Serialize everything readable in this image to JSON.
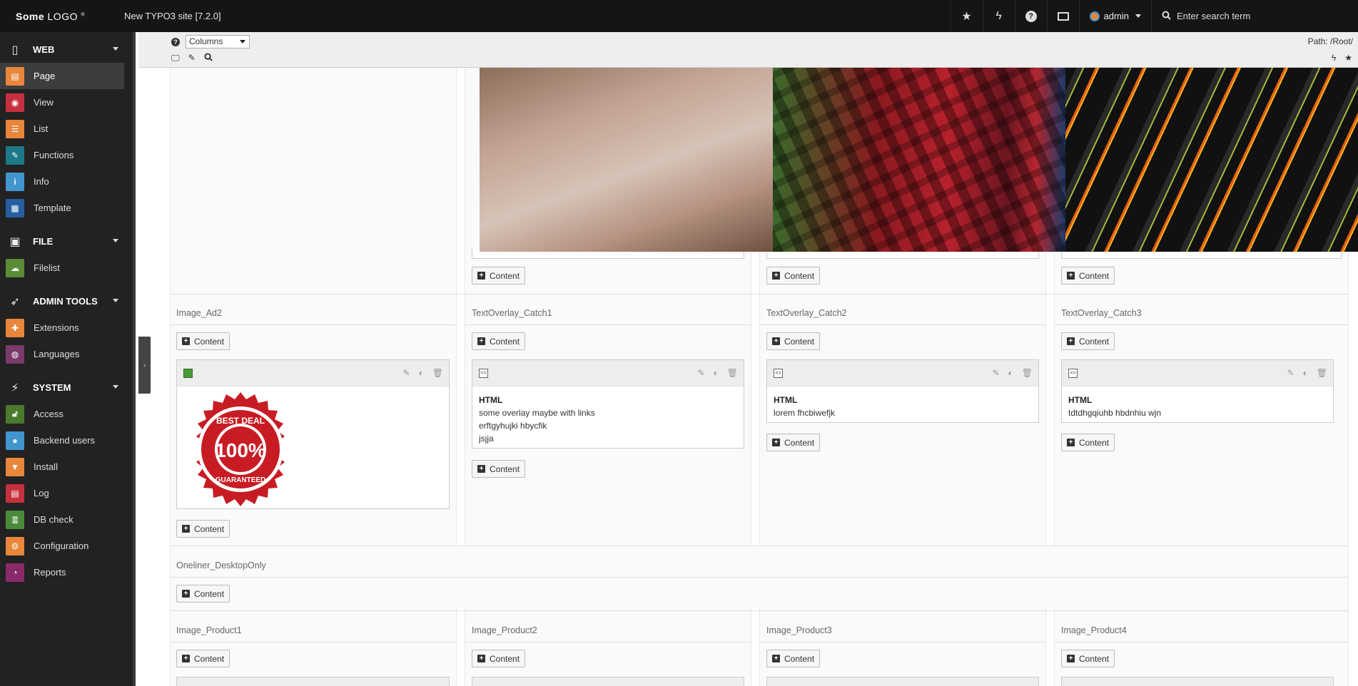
{
  "topbar": {
    "logo_bold": "Some",
    "logo_light": "LOGO",
    "site_name": "New TYPO3 site [7.2.0]",
    "user": "admin",
    "search_placeholder": "Enter search term"
  },
  "sidebar": {
    "sections": [
      {
        "label": "WEB",
        "icon": "page-icon",
        "items": [
          {
            "label": "Page",
            "icon": "page-module-icon",
            "color": "#e8863b",
            "active": true
          },
          {
            "label": "View",
            "icon": "eye-icon",
            "color": "#c6303e"
          },
          {
            "label": "List",
            "icon": "list-icon",
            "color": "#e8863b"
          },
          {
            "label": "Functions",
            "icon": "wand-icon",
            "color": "#1d7888"
          },
          {
            "label": "Info",
            "icon": "info-icon",
            "color": "#4196ce"
          },
          {
            "label": "Template",
            "icon": "template-icon",
            "color": "#255fa2"
          }
        ]
      },
      {
        "label": "FILE",
        "icon": "image-icon",
        "items": [
          {
            "label": "Filelist",
            "icon": "cloud-icon",
            "color": "#5a8c35"
          }
        ]
      },
      {
        "label": "ADMIN TOOLS",
        "icon": "rocket-icon",
        "items": [
          {
            "label": "Extensions",
            "icon": "puzzle-icon",
            "color": "#e8863b"
          },
          {
            "label": "Languages",
            "icon": "globe-icon",
            "color": "#7a3a6a"
          }
        ]
      },
      {
        "label": "SYSTEM",
        "icon": "plug-icon",
        "items": [
          {
            "label": "Access",
            "icon": "lock-icon",
            "color": "#4a7a2c"
          },
          {
            "label": "Backend users",
            "icon": "user-icon",
            "color": "#4196ce"
          },
          {
            "label": "Install",
            "icon": "typo3-icon",
            "color": "#e8863b"
          },
          {
            "label": "Log",
            "icon": "log-icon",
            "color": "#c6303e"
          },
          {
            "label": "DB check",
            "icon": "database-icon",
            "color": "#4a8a3a"
          },
          {
            "label": "Configuration",
            "icon": "config-icon",
            "color": "#e8863b"
          },
          {
            "label": "Reports",
            "icon": "pie-chart-icon",
            "color": "#8a2a6a"
          }
        ]
      }
    ]
  },
  "docheader": {
    "view_select": "Columns",
    "path": "Path: /Root/"
  },
  "content_button": "Content",
  "columns": {
    "row1": [
      "Image_Ad2",
      "TextOverlay_Catch1",
      "TextOverlay_Catch2",
      "TextOverlay_Catch3"
    ],
    "row2": [
      "Oneliner_DesktopOnly"
    ],
    "row3": [
      "Image_Product1",
      "Image_Product2",
      "Image_Product3",
      "Image_Product4"
    ]
  },
  "elements": {
    "badge_alt": "BEST DEAL 100% GUARANTEED",
    "badge_top": "BEST DEAL",
    "badge_mid": "100%",
    "badge_bottom": "GUARANTEED",
    "catch1": {
      "type": "HTML",
      "lines": [
        "some overlay maybe with links",
        "erftgyhujki hbycfik",
        "jsjja"
      ]
    },
    "catch2": {
      "type": "HTML",
      "lines": [
        "lorem fhcbiwefjk"
      ]
    },
    "catch3": {
      "type": "HTML",
      "lines": [
        "tdtdhgqiuhb hbdnhiu wjn"
      ]
    }
  }
}
